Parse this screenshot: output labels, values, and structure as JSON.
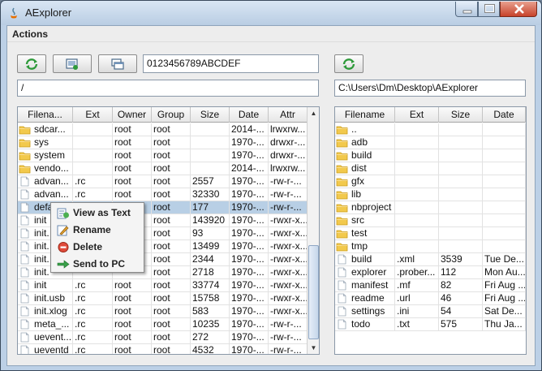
{
  "window": {
    "title": "AExplorer"
  },
  "menubar": {
    "actions": "Actions"
  },
  "device": {
    "toolbar": {
      "refresh_icon": "refresh-icon",
      "screenshot_icon": "screenshot-icon",
      "windows_icon": "windows-icon"
    },
    "serial": "0123456789ABCDEF",
    "path": "/",
    "columns": [
      "Filena...",
      "Ext",
      "Owner",
      "Group",
      "Size",
      "Date",
      "Attr"
    ],
    "rows": [
      {
        "type": "folder",
        "name": "sdcar...",
        "ext": "",
        "owner": "root",
        "group": "root",
        "size": "",
        "date": "2014-...",
        "attr": "lrwxrw..."
      },
      {
        "type": "folder",
        "name": "sys",
        "ext": "",
        "owner": "root",
        "group": "root",
        "size": "",
        "date": "1970-...",
        "attr": "drwxr-..."
      },
      {
        "type": "folder",
        "name": "system",
        "ext": "",
        "owner": "root",
        "group": "root",
        "size": "",
        "date": "1970-...",
        "attr": "drwxr-..."
      },
      {
        "type": "folder",
        "name": "vendo...",
        "ext": "",
        "owner": "root",
        "group": "root",
        "size": "",
        "date": "2014-...",
        "attr": "lrwxrw..."
      },
      {
        "type": "file",
        "name": "advan...",
        "ext": ".rc",
        "owner": "root",
        "group": "root",
        "size": "2557",
        "date": "1970-...",
        "attr": "-rw-r-..."
      },
      {
        "type": "file",
        "name": "advan...",
        "ext": ".rc",
        "owner": "root",
        "group": "root",
        "size": "32330",
        "date": "1970-...",
        "attr": "-rw-r-..."
      },
      {
        "type": "file",
        "name": "defa",
        "ext": "",
        "owner": "",
        "group": "root",
        "size": "177",
        "date": "1970-...",
        "attr": "-rw-r-...",
        "selected": true
      },
      {
        "type": "file",
        "name": "init",
        "ext": "",
        "owner": "",
        "group": "root",
        "size": "143920",
        "date": "1970-...",
        "attr": "-rwxr-x..."
      },
      {
        "type": "file",
        "name": "init.",
        "ext": "",
        "owner": "",
        "group": "root",
        "size": "93",
        "date": "1970-...",
        "attr": "-rwxr-x..."
      },
      {
        "type": "file",
        "name": "init.",
        "ext": "",
        "owner": "",
        "group": "root",
        "size": "13499",
        "date": "1970-...",
        "attr": "-rwxr-x..."
      },
      {
        "type": "file",
        "name": "init.",
        "ext": "",
        "owner": "",
        "group": "root",
        "size": "2344",
        "date": "1970-...",
        "attr": "-rwxr-x..."
      },
      {
        "type": "file",
        "name": "init.",
        "ext": "",
        "owner": "",
        "group": "root",
        "size": "2718",
        "date": "1970-...",
        "attr": "-rwxr-x..."
      },
      {
        "type": "file",
        "name": "init",
        "ext": ".rc",
        "owner": "root",
        "group": "root",
        "size": "33774",
        "date": "1970-...",
        "attr": "-rwxr-x..."
      },
      {
        "type": "file",
        "name": "init.usb",
        "ext": ".rc",
        "owner": "root",
        "group": "root",
        "size": "15758",
        "date": "1970-...",
        "attr": "-rwxr-x..."
      },
      {
        "type": "file",
        "name": "init.xlog",
        "ext": ".rc",
        "owner": "root",
        "group": "root",
        "size": "583",
        "date": "1970-...",
        "attr": "-rwxr-x..."
      },
      {
        "type": "file",
        "name": "meta_...",
        "ext": ".rc",
        "owner": "root",
        "group": "root",
        "size": "10235",
        "date": "1970-...",
        "attr": "-rw-r-..."
      },
      {
        "type": "file",
        "name": "uevent...",
        "ext": ".rc",
        "owner": "root",
        "group": "root",
        "size": "272",
        "date": "1970-...",
        "attr": "-rw-r-..."
      },
      {
        "type": "file",
        "name": "ueventd",
        "ext": ".rc",
        "owner": "root",
        "group": "root",
        "size": "4532",
        "date": "1970-...",
        "attr": "-rw-r-..."
      }
    ]
  },
  "pc": {
    "toolbar": {
      "refresh_icon": "refresh-icon"
    },
    "path": "C:\\Users\\Dm\\Desktop\\AExplorer",
    "columns": [
      "Filename",
      "Ext",
      "Size",
      "Date"
    ],
    "rows": [
      {
        "type": "folder",
        "name": "..",
        "ext": "",
        "size": "",
        "date": ""
      },
      {
        "type": "folder",
        "name": "adb",
        "ext": "",
        "size": "",
        "date": ""
      },
      {
        "type": "folder",
        "name": "build",
        "ext": "",
        "size": "",
        "date": ""
      },
      {
        "type": "folder",
        "name": "dist",
        "ext": "",
        "size": "",
        "date": ""
      },
      {
        "type": "folder",
        "name": "gfx",
        "ext": "",
        "size": "",
        "date": ""
      },
      {
        "type": "folder",
        "name": "lib",
        "ext": "",
        "size": "",
        "date": ""
      },
      {
        "type": "folder",
        "name": "nbproject",
        "ext": "",
        "size": "",
        "date": ""
      },
      {
        "type": "folder",
        "name": "src",
        "ext": "",
        "size": "",
        "date": ""
      },
      {
        "type": "folder",
        "name": "test",
        "ext": "",
        "size": "",
        "date": ""
      },
      {
        "type": "folder",
        "name": "tmp",
        "ext": "",
        "size": "",
        "date": ""
      },
      {
        "type": "file",
        "name": "build",
        "ext": ".xml",
        "size": "3539",
        "date": "Tue De..."
      },
      {
        "type": "file",
        "name": "explorer",
        "ext": ".prober...",
        "size": "112",
        "date": "Mon Au..."
      },
      {
        "type": "file",
        "name": "manifest",
        "ext": ".mf",
        "size": "82",
        "date": "Fri Aug ..."
      },
      {
        "type": "file",
        "name": "readme",
        "ext": ".url",
        "size": "46",
        "date": "Fri Aug ..."
      },
      {
        "type": "file",
        "name": "settings",
        "ext": ".ini",
        "size": "54",
        "date": "Sat De..."
      },
      {
        "type": "file",
        "name": "todo",
        "ext": ".txt",
        "size": "575",
        "date": "Thu Ja..."
      }
    ]
  },
  "context_menu": {
    "items": [
      {
        "label": "View as Text",
        "icon": "view-text-icon"
      },
      {
        "label": "Rename",
        "icon": "rename-icon"
      },
      {
        "label": "Delete",
        "icon": "delete-icon"
      },
      {
        "label": "Send to PC",
        "icon": "send-arrow-icon"
      }
    ]
  },
  "colors": {
    "selection": "#b8cfe5",
    "folder": "#f2c94c",
    "title_bar": "#c7d7ea"
  }
}
